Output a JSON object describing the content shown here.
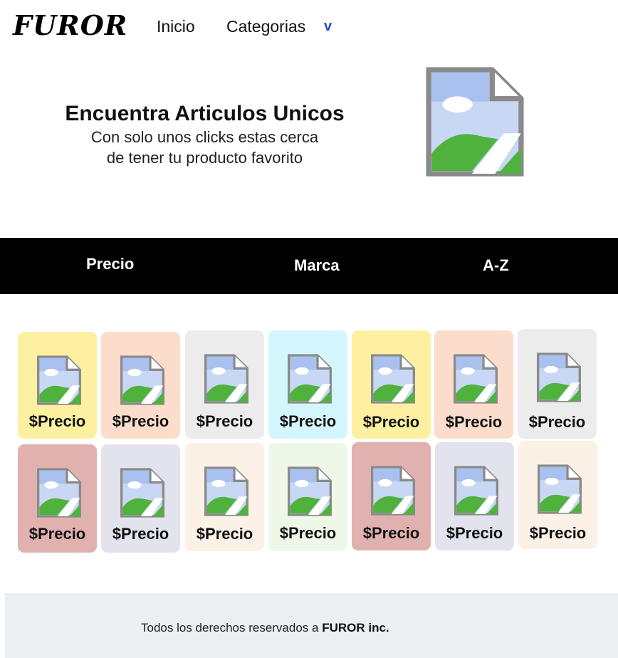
{
  "header": {
    "logo": "FUROR",
    "nav": {
      "inicio": "Inicio",
      "categorias": "Categorias",
      "categorias_caret": "v"
    }
  },
  "hero": {
    "title": "Encuentra Articulos Unicos",
    "subtitle_line1": "Con solo unos clicks estas cerca",
    "subtitle_line2": "de tener tu producto favorito",
    "image_icon": "broken-image-icon"
  },
  "filters": {
    "precio": "Precio",
    "marca": "Marca",
    "az": "A-Z"
  },
  "products": {
    "row1": [
      {
        "price": "$Precio",
        "color": "#fdf0a1"
      },
      {
        "price": "$Precio",
        "color": "#fcdccb"
      },
      {
        "price": "$Precio",
        "color": "#ececec"
      },
      {
        "price": "$Precio",
        "color": "#d3f6fd"
      },
      {
        "price": "$Precio",
        "color": "#fdf0a1"
      },
      {
        "price": "$Precio",
        "color": "#fcdccb"
      },
      {
        "price": "$Precio",
        "color": "#ececec"
      }
    ],
    "row2": [
      {
        "price": "$Precio",
        "color": "#e0b1ae"
      },
      {
        "price": "$Precio",
        "color": "#e2e3ec"
      },
      {
        "price": "$Precio",
        "color": "#fcf1e6"
      },
      {
        "price": "$Precio",
        "color": "#eef8e9"
      },
      {
        "price": "$Precio",
        "color": "#e0b1ae"
      },
      {
        "price": "$Precio",
        "color": "#e2e3ec"
      },
      {
        "price": "$Precio",
        "color": "#fcf1e6"
      }
    ]
  },
  "footer": {
    "text": "Todos los derechos reservados a ",
    "company": "FUROR inc."
  }
}
